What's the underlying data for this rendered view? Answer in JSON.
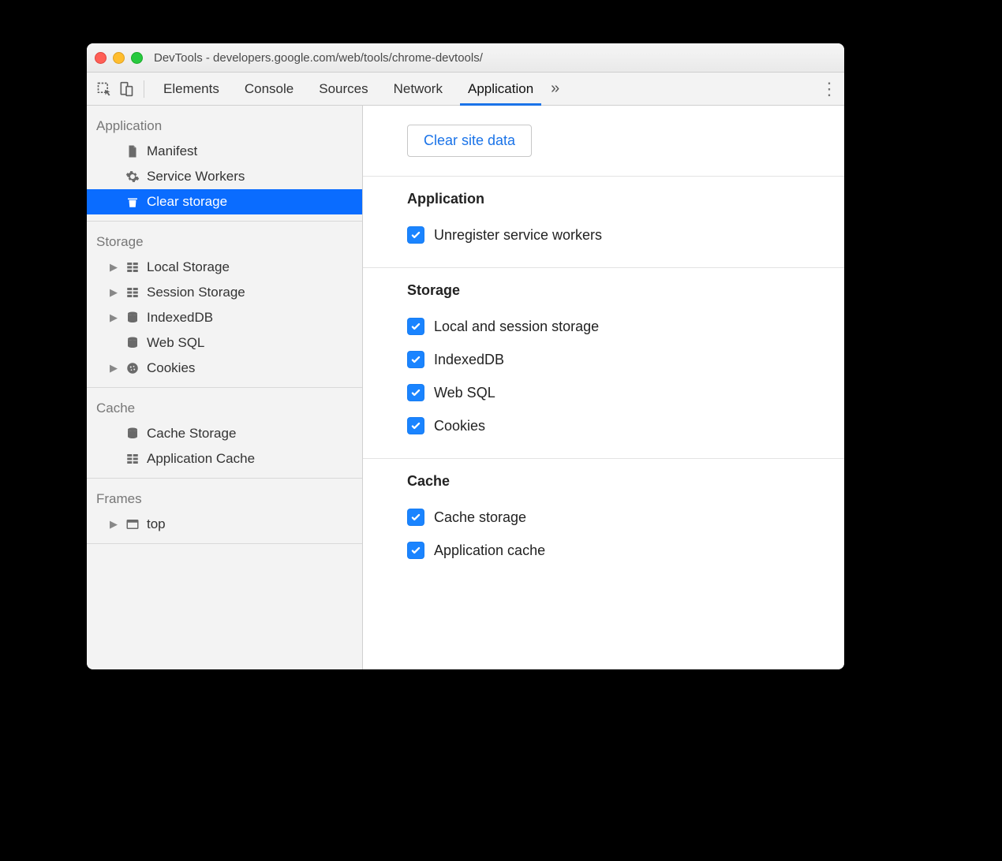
{
  "window": {
    "title": "DevTools - developers.google.com/web/tools/chrome-devtools/"
  },
  "toolbar": {
    "tabs": [
      "Elements",
      "Console",
      "Sources",
      "Network",
      "Application"
    ],
    "active_tab": "Application"
  },
  "sidebar": {
    "sections": [
      {
        "title": "Application",
        "items": [
          {
            "icon": "file-icon",
            "label": "Manifest",
            "expandable": false
          },
          {
            "icon": "gear-icon",
            "label": "Service Workers",
            "expandable": false
          },
          {
            "icon": "trash-icon",
            "label": "Clear storage",
            "expandable": false,
            "selected": true
          }
        ]
      },
      {
        "title": "Storage",
        "items": [
          {
            "icon": "grid-icon",
            "label": "Local Storage",
            "expandable": true
          },
          {
            "icon": "grid-icon",
            "label": "Session Storage",
            "expandable": true
          },
          {
            "icon": "db-icon",
            "label": "IndexedDB",
            "expandable": true
          },
          {
            "icon": "db-icon",
            "label": "Web SQL",
            "expandable": false
          },
          {
            "icon": "cookie-icon",
            "label": "Cookies",
            "expandable": true
          }
        ]
      },
      {
        "title": "Cache",
        "items": [
          {
            "icon": "db-icon",
            "label": "Cache Storage",
            "expandable": false
          },
          {
            "icon": "grid-icon",
            "label": "Application Cache",
            "expandable": false
          }
        ]
      },
      {
        "title": "Frames",
        "items": [
          {
            "icon": "frame-icon",
            "label": "top",
            "expandable": true
          }
        ]
      }
    ]
  },
  "main": {
    "clear_button_label": "Clear site data",
    "groups": [
      {
        "title": "Application",
        "checks": [
          {
            "label": "Unregister service workers",
            "checked": true
          }
        ]
      },
      {
        "title": "Storage",
        "checks": [
          {
            "label": "Local and session storage",
            "checked": true
          },
          {
            "label": "IndexedDB",
            "checked": true
          },
          {
            "label": "Web SQL",
            "checked": true
          },
          {
            "label": "Cookies",
            "checked": true
          }
        ]
      },
      {
        "title": "Cache",
        "checks": [
          {
            "label": "Cache storage",
            "checked": true
          },
          {
            "label": "Application cache",
            "checked": true
          }
        ]
      }
    ]
  }
}
